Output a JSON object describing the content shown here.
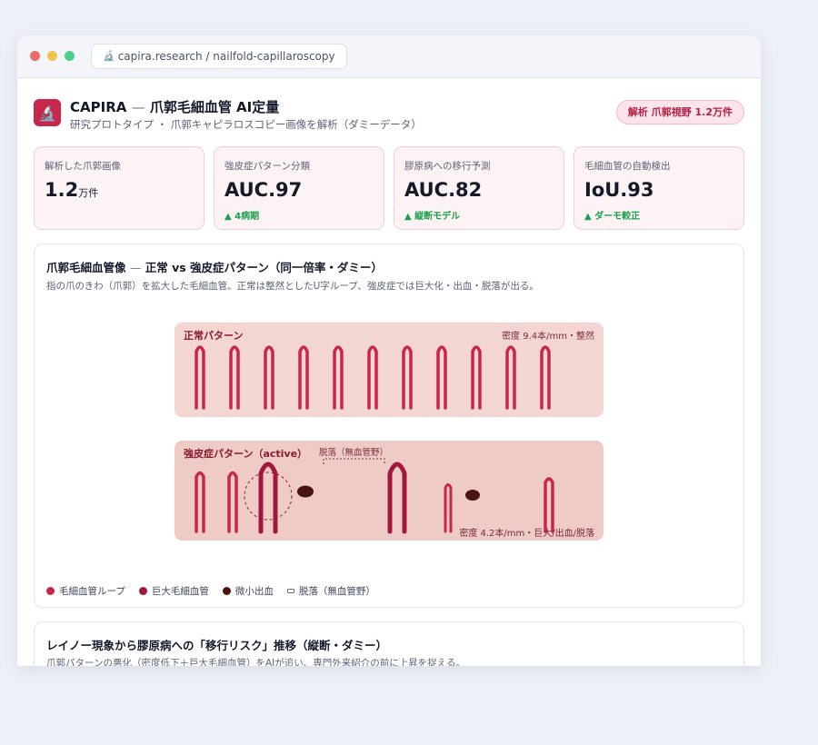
{
  "browser": {
    "url": "capira.research / nailfold-capillaroscopy",
    "url_icon": "microscope-icon"
  },
  "header": {
    "brand": "CAPIRA",
    "dash": "—",
    "title": "爪郭毛細血管 AI定量",
    "subtitle": "研究プロトタイプ ・ 爪郭キャピラロスコピー画像を解析（ダミーデータ）",
    "badge": "解析 爪郭視野 1.2万件",
    "logo_icon": "microscope-icon"
  },
  "kpis": [
    {
      "label": "解析した爪郭画像",
      "value": "1.2",
      "unit": "万件",
      "delta": ""
    },
    {
      "label": "強皮症パターン分類",
      "value": "AUC.97",
      "unit": "",
      "delta": "▲ 4病期"
    },
    {
      "label": "膠原病への移行予測",
      "value": "AUC.82",
      "unit": "",
      "delta": "▲ 縦断モデル"
    },
    {
      "label": "毛細血管の自動検出",
      "value": "IoU.93",
      "unit": "",
      "delta": "▲ ダーモ較正"
    }
  ],
  "capillary_card": {
    "title_a": "爪郭毛細血管像",
    "title_dash": "—",
    "title_b": "正常 vs 強皮症パターン（同一倍率・ダミー）",
    "desc": "指の爪のきわ（爪郭）を拡大した毛細血管。正常は整然としたU字ループ、強皮症では巨大化・出血・脱落が出る。",
    "normal": {
      "label": "正常パターン",
      "density": "密度 9.4本/mm・整然"
    },
    "scleroderma": {
      "label": "強皮症パターン（active）",
      "dropout_label": "脱落（無血管野）",
      "density": "密度 4.2本/mm・巨大/出血/脱落"
    },
    "legend": [
      {
        "label": "毛細血管ループ",
        "color": "#c8264a",
        "kind": "dot"
      },
      {
        "label": "巨大毛細血管",
        "color": "#a3183a",
        "kind": "dot"
      },
      {
        "label": "微小出血",
        "color": "#4a1414",
        "kind": "dot"
      },
      {
        "label": "脱落（無血管野）",
        "color": "#6a7088",
        "kind": "rect"
      }
    ],
    "colors": {
      "normal_bg": "#f3d6d2",
      "sclero_bg": "#efcbc6",
      "loop": "#c8264a",
      "giant": "#a3183a",
      "hemorrhage": "#4a1414"
    }
  },
  "risk_card": {
    "title": "レイノー現象から膠原病への「移行リスク」推移（縦断・ダミー）",
    "desc": "爪郭パターンの悪化（密度低下＋巨大毛細血管）をAIが追い、専門外来紹介の前に上昇を捉える。"
  }
}
